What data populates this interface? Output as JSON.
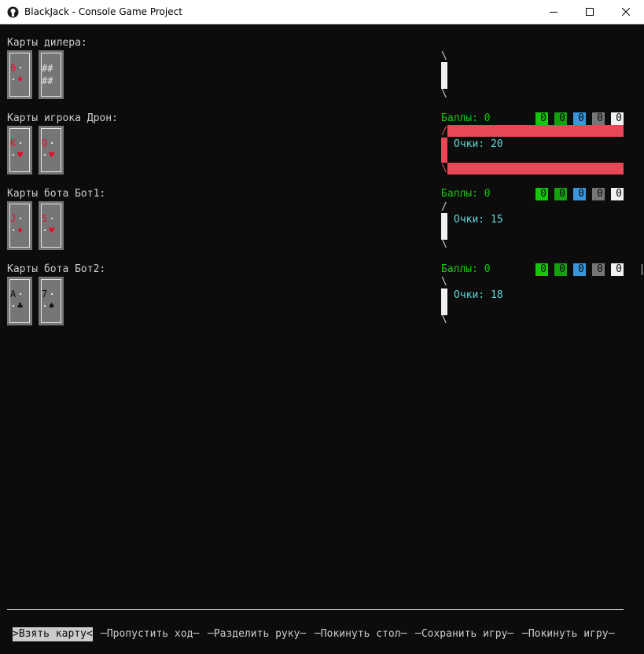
{
  "window": {
    "title": "BlackJack - Console Game Project",
    "icon": "blackjack-app-icon",
    "controls": [
      "minimize-icon",
      "maximize-icon",
      "close-icon"
    ]
  },
  "colors": {
    "console_bg": "#0c0c0c",
    "text": "#cccccc",
    "red_suit": "#e0102e",
    "card_gray": "#767676",
    "active_bar": "#e74856",
    "score_cyan": "#61d6d6",
    "balls_green": "#16c60c",
    "chip_colors": [
      "#16c60c",
      "#13a10e",
      "#3a96dd",
      "#767676",
      "#f2f2f2"
    ]
  },
  "dealer": {
    "label": "Карты дилера:",
    "cards": [
      {
        "rank": "6",
        "suit": "♦",
        "color": "red"
      },
      {
        "back_top": "##",
        "back_bottom": "##"
      }
    ],
    "slash_top": "\\",
    "slash_bottom": "\\"
  },
  "players": [
    {
      "label": "Карты игрока Дрон:",
      "balls": "Баллы: 0",
      "chips": [
        "0",
        "0",
        "0",
        "0",
        "0"
      ],
      "cards": [
        {
          "rank": "K",
          "suit": "♥",
          "color": "red"
        },
        {
          "rank": "Q",
          "suit": "♥",
          "color": "red"
        }
      ],
      "score": "Очки: 20",
      "slash_top": "/",
      "slash_bottom": "\\",
      "active": true
    },
    {
      "label": "Карты бота Бот1:",
      "balls": "Баллы: 0",
      "chips": [
        "0",
        "0",
        "0",
        "0",
        "0"
      ],
      "cards": [
        {
          "rank": "J",
          "suit": "♦",
          "color": "red"
        },
        {
          "rank": "5",
          "suit": "♥",
          "color": "red"
        }
      ],
      "score": "Очки: 15",
      "slash_top": "/",
      "slash_bottom": "\\",
      "active": false
    },
    {
      "label": "Карты бота Бот2:",
      "balls": "Баллы: 0",
      "chips": [
        "0",
        "0",
        "0",
        "0",
        "0"
      ],
      "cards": [
        {
          "rank": "A",
          "suit": "♣",
          "color": "black"
        },
        {
          "rank": "7",
          "suit": "♠",
          "color": "black"
        }
      ],
      "score": "Очки: 18",
      "slash_top": "\\",
      "slash_bottom": "\\",
      "active": false
    }
  ],
  "menu": [
    {
      "label": ">Взять карту<",
      "selected": true
    },
    {
      "label": "─Пропустить ход─",
      "selected": false
    },
    {
      "label": "─Разделить руку─",
      "selected": false
    },
    {
      "label": "─Покинуть стол─",
      "selected": false
    },
    {
      "label": "─Сохранить игру─",
      "selected": false
    },
    {
      "label": "─Покинуть игру─",
      "selected": false
    }
  ]
}
